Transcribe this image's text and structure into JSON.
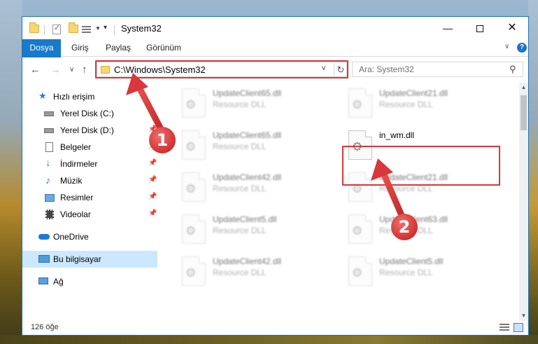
{
  "window": {
    "title": "System32",
    "minimize_glyph": "—",
    "close_glyph": "✕"
  },
  "ribbon": {
    "tabs": [
      "Dosya",
      "Giriş",
      "Paylaş",
      "Görünüm"
    ],
    "collapse_glyph": "∨",
    "help_glyph": "?"
  },
  "navbar": {
    "back_glyph": "←",
    "forward_glyph": "→",
    "recent_glyph": "∨",
    "up_glyph": "↑",
    "address": "C:\\Windows\\System32",
    "dropdown_glyph": "∨",
    "refresh_glyph": "↻",
    "search_placeholder": "Ara: System32",
    "search_glyph": "⚲"
  },
  "sidebar": {
    "items": [
      {
        "label": "Hızlı erişim",
        "icon": "star-icon"
      },
      {
        "label": "Yerel Disk (C:)",
        "icon": "drive-icon"
      },
      {
        "label": "Yerel Disk (D:)",
        "icon": "drive-icon"
      },
      {
        "label": "Belgeler",
        "icon": "documents-icon"
      },
      {
        "label": "İndirmeler",
        "icon": "download-icon"
      },
      {
        "label": "Müzik",
        "icon": "music-icon"
      },
      {
        "label": "Resimler",
        "icon": "pictures-icon"
      },
      {
        "label": "Videolar",
        "icon": "video-icon"
      },
      {
        "label": "OneDrive",
        "icon": "cloud-icon"
      },
      {
        "label": "Bu bilgisayar",
        "icon": "computer-icon"
      },
      {
        "label": "Ağ",
        "icon": "network-icon"
      }
    ],
    "pin_glyph": "📌"
  },
  "files": [
    {
      "name": "UpdateClient65.dll",
      "type": "Resource DLL"
    },
    {
      "name": "UpdateClient21.dll",
      "type": "Resource DLL"
    },
    {
      "name": "UpdateClient65.dll",
      "type": "Resource DLL"
    },
    {
      "name": "in_wm.dll",
      "type": ""
    },
    {
      "name": "UpdateClient42.dll",
      "type": "Resource DLL"
    },
    {
      "name": "UpdateClient21.dll",
      "type": "Resource DLL"
    },
    {
      "name": "UpdateClient5.dll",
      "type": "Resource DLL"
    },
    {
      "name": "UpdateClient63.dll",
      "type": "Resource DLL"
    },
    {
      "name": "UpdateClient42.dll",
      "type": "Resource DLL"
    },
    {
      "name": "UpdateClient5.dll",
      "type": "Resource DLL"
    }
  ],
  "file_icon_glyph": "⚙",
  "scrollbar": {
    "up_glyph": "▲",
    "down_glyph": "▼"
  },
  "status": {
    "item_count": "126 öğe"
  },
  "annotations": {
    "step1": "1",
    "step2": "2",
    "color": "#d9373b"
  }
}
